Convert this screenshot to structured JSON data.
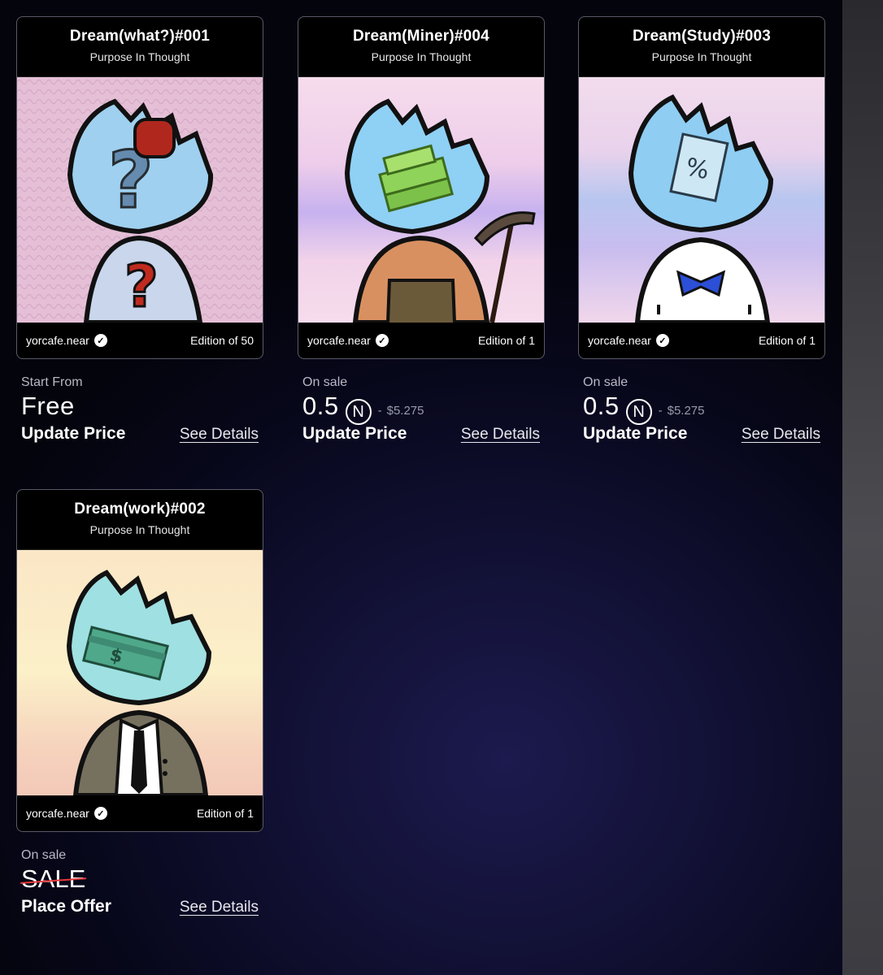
{
  "cards": [
    {
      "title": "Dream(what?)#001",
      "subtitle": "Purpose In Thought",
      "creator": "yorcafe.near",
      "edition": "Edition of 50",
      "sale_status": "Start From",
      "price": "Free",
      "action_label": "Update Price",
      "details_label": "See Details"
    },
    {
      "title": "Dream(Miner)#004",
      "subtitle": "Purpose In Thought",
      "creator": "yorcafe.near",
      "edition": "Edition of 1",
      "sale_status": "On sale",
      "price": "0.5",
      "currency_symbol": "N",
      "fiat_dash": "-",
      "fiat_price": "$5.275",
      "action_label": "Update Price",
      "details_label": "See Details"
    },
    {
      "title": "Dream(Study)#003",
      "subtitle": "Purpose In Thought",
      "creator": "yorcafe.near",
      "edition": "Edition of 1",
      "sale_status": "On sale",
      "price": "0.5",
      "currency_symbol": "N",
      "fiat_dash": "-",
      "fiat_price": "$5.275",
      "action_label": "Update Price",
      "details_label": "See Details"
    },
    {
      "title": "Dream(work)#002",
      "subtitle": "Purpose In Thought",
      "creator": "yorcafe.near",
      "edition": "Edition of 1",
      "sale_status": "On sale",
      "price": "SALE",
      "action_label": "Place Offer",
      "details_label": "See Details"
    }
  ],
  "icons": {
    "verified": "verified-badge-icon",
    "currency": "near-currency-icon"
  },
  "colors": {
    "card_border": "#5a5a68",
    "strike_red": "#e53a3a",
    "fiat_gray": "#9a9aac"
  }
}
